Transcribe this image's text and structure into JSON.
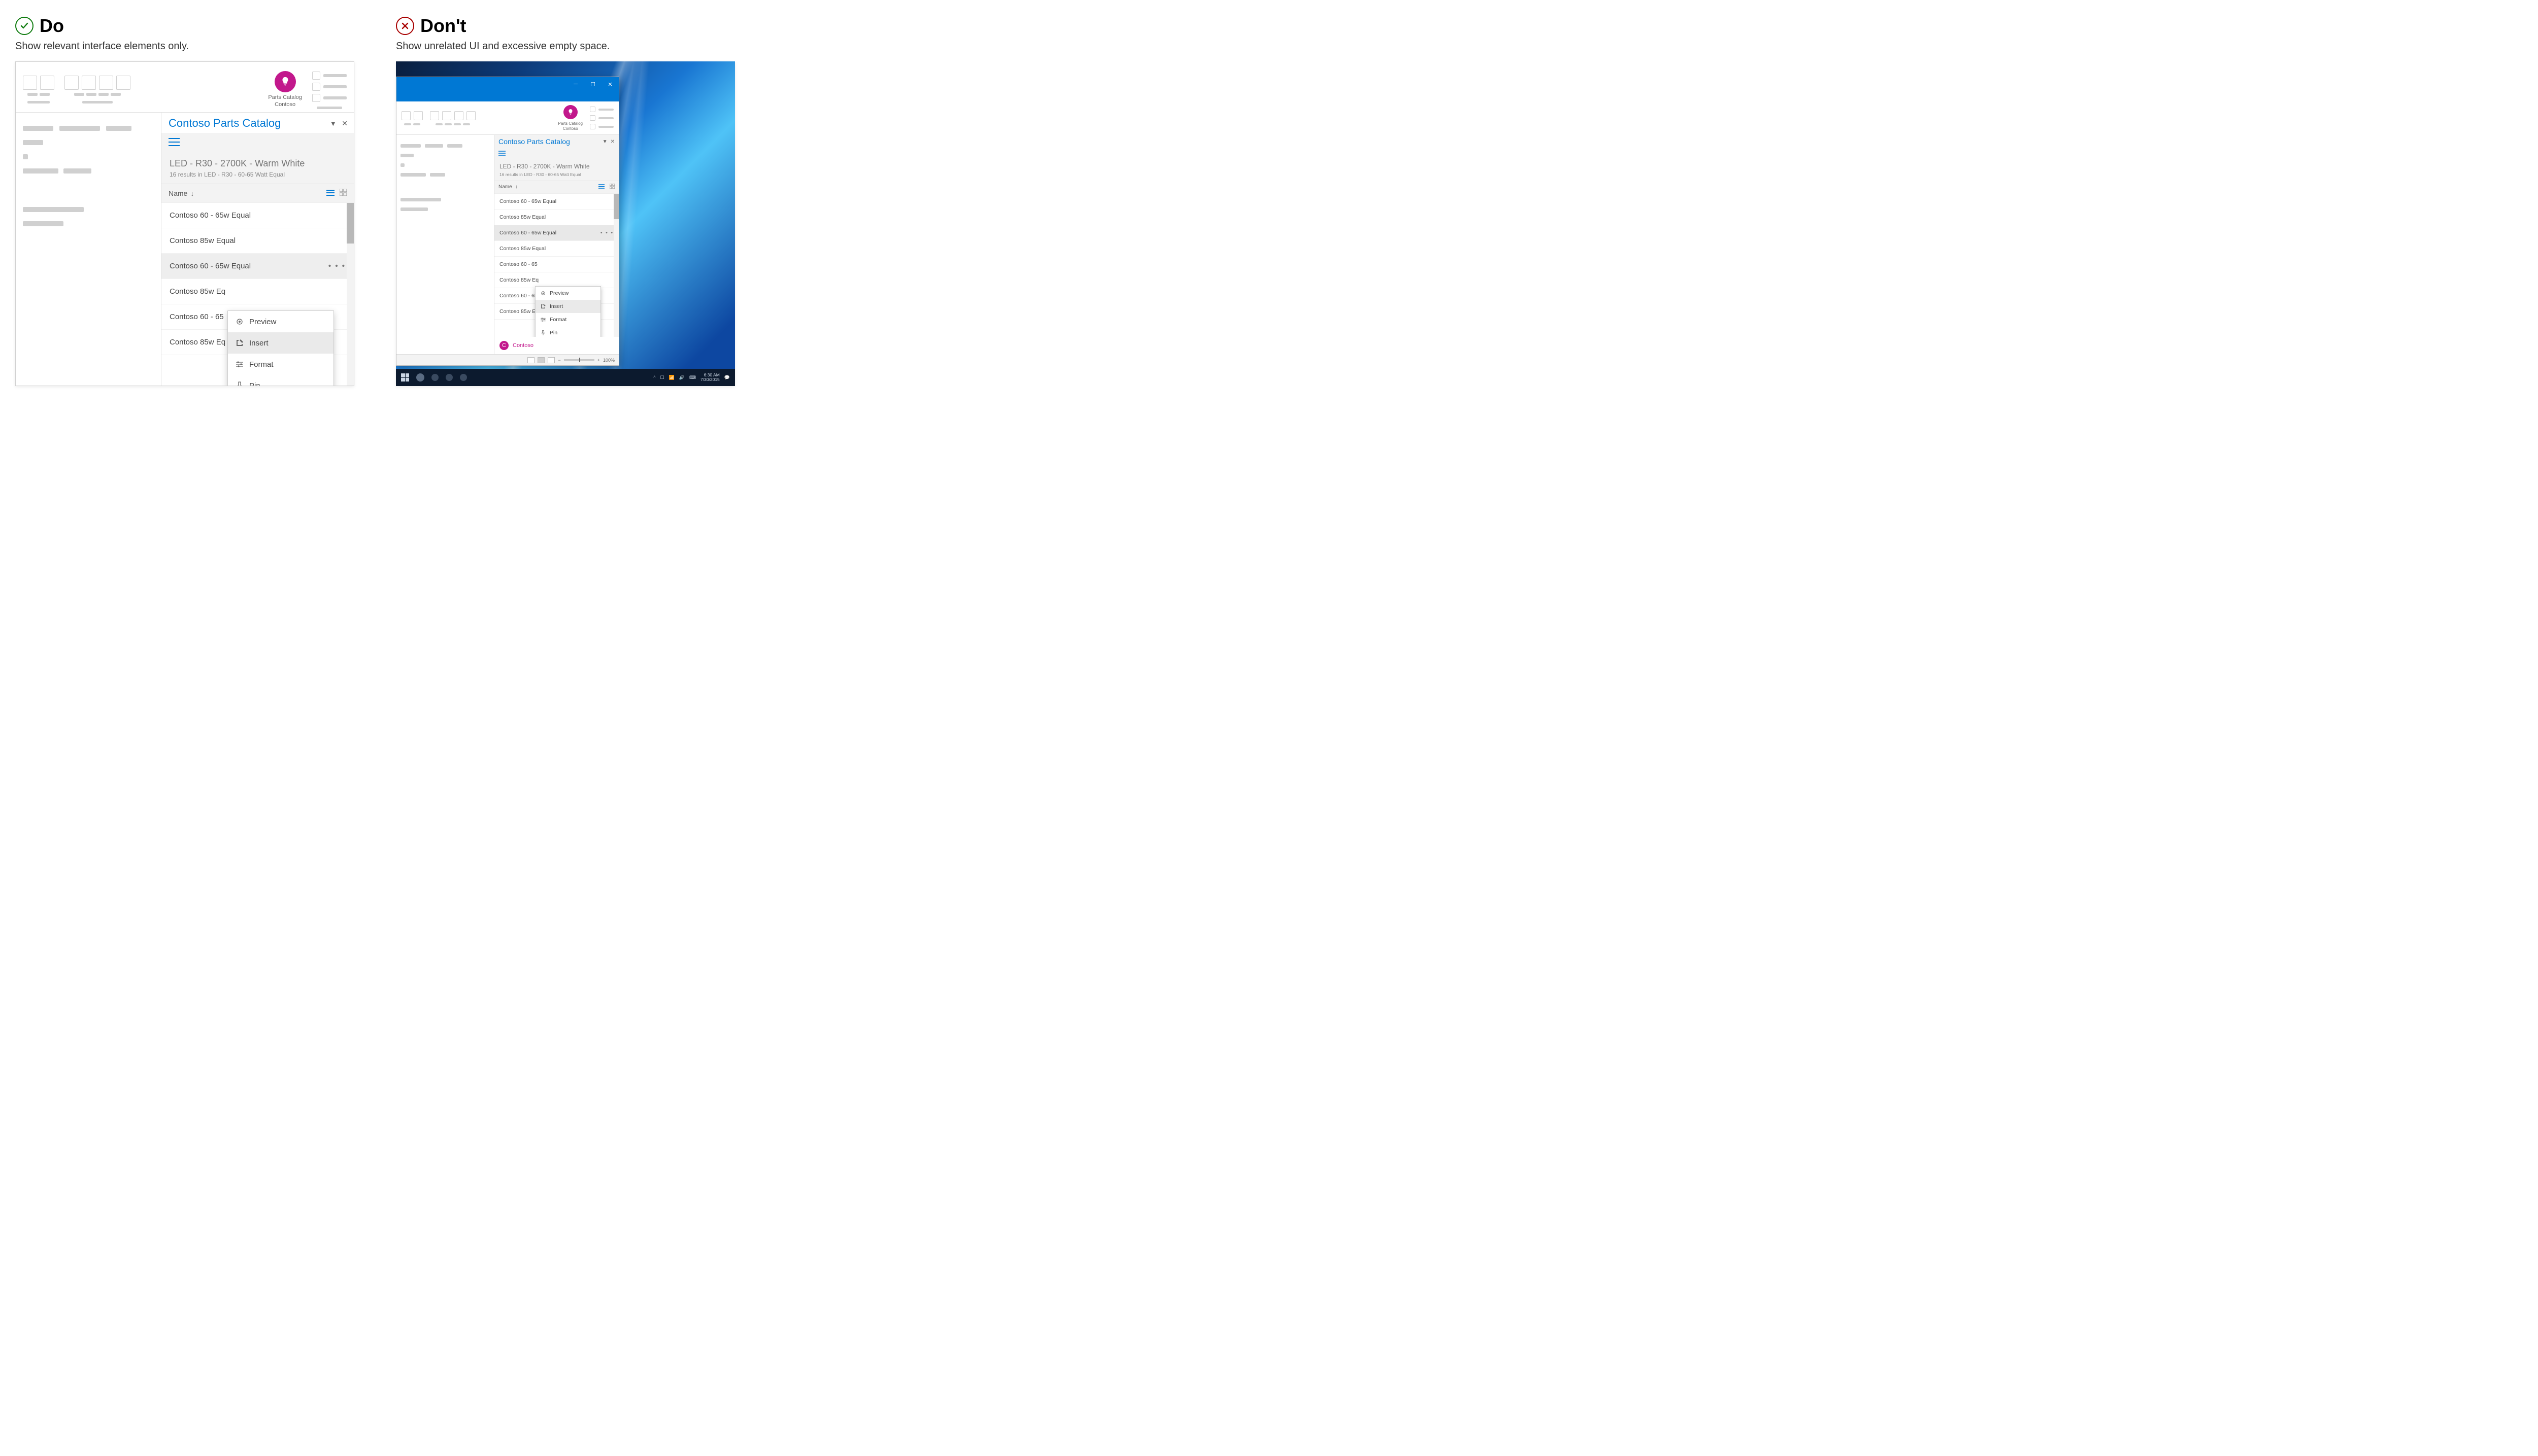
{
  "do": {
    "heading": "Do",
    "subtext": "Show relevant interface elements only.",
    "ribbon_addin": {
      "line1": "Parts Catalog",
      "line2": "Contoso"
    },
    "taskpane": {
      "title": "Contoso Parts Catalog",
      "filter_title": "LED - R30 - 2700K - Warm White",
      "filter_sub": "16 results in LED - R30 - 60-65 Watt Equal",
      "column_label": "Name",
      "items": [
        "Contoso 60 - 65w Equal",
        "Contoso 85w Equal",
        "Contoso 60 - 65w Equal",
        "Contoso 85w Eq",
        "Contoso 60 - 65",
        "Contoso 85w Eq"
      ],
      "context_menu": {
        "preview": "Preview",
        "insert": "Insert",
        "format": "Format",
        "pin": "Pin"
      }
    }
  },
  "dont": {
    "heading": "Don't",
    "subtext": "Show unrelated UI and excessive empty space.",
    "ribbon_addin": {
      "line1": "Parts Catalog",
      "line2": "Contoso"
    },
    "taskpane": {
      "title": "Contoso Parts Catalog",
      "filter_title": "LED - R30 - 2700K - Warm White",
      "filter_sub": "16 results in LED - R30 - 60-65 Watt Equal",
      "column_label": "Name",
      "items": [
        "Contoso 60 - 65w Equal",
        "Contoso 85w Equal",
        "Contoso 60 - 65w Equal",
        "Contoso 85w Equal",
        "Contoso 60 - 65",
        "Contoso 85w Eq",
        "Contoso 60 - 65w Equal",
        "Contoso 85w Equal"
      ],
      "context_menu": {
        "preview": "Preview",
        "insert": "Insert",
        "format": "Format",
        "pin": "Pin"
      },
      "brand_initial": "C",
      "brand_name": "Contoso"
    },
    "statusbar": {
      "zoom_minus": "−",
      "zoom_plus": "+",
      "zoom_value": "100%"
    },
    "taskbar": {
      "time": "6:30 AM",
      "date": "7/30/2015"
    }
  }
}
